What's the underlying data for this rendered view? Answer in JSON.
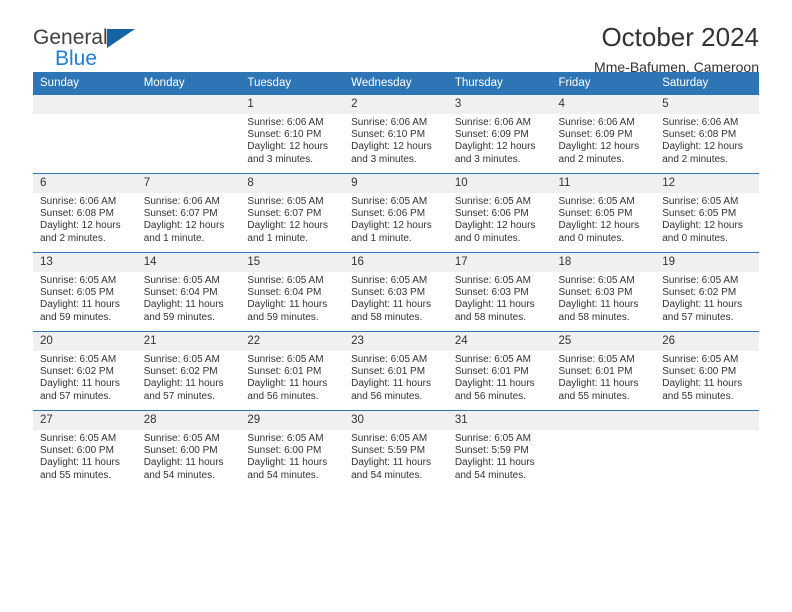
{
  "brand": {
    "name_top": "General",
    "name_bottom": "Blue",
    "triangle_color": "#1464a5",
    "blue_text_color": "#1b7fd4"
  },
  "header": {
    "title": "October 2024",
    "subtitle": "Mme-Bafumen, Cameroon",
    "accent_color": "#2e75b6",
    "daynum_band_color": "#f0f0f0"
  },
  "calendar": {
    "weekday_headers": [
      "Sunday",
      "Monday",
      "Tuesday",
      "Wednesday",
      "Thursday",
      "Friday",
      "Saturday"
    ],
    "labels": {
      "sunrise_prefix": "Sunrise:",
      "sunset_prefix": "Sunset:",
      "daylight_prefix": "Daylight:"
    },
    "weeks": [
      [
        {
          "day": "",
          "empty": true,
          "sunrise": "",
          "sunset": "",
          "daylight_line1": "",
          "daylight_line2": ""
        },
        {
          "day": "",
          "empty": true,
          "sunrise": "",
          "sunset": "",
          "daylight_line1": "",
          "daylight_line2": ""
        },
        {
          "day": "1",
          "sunrise": "Sunrise: 6:06 AM",
          "sunset": "Sunset: 6:10 PM",
          "daylight_line1": "Daylight: 12 hours",
          "daylight_line2": "and 3 minutes."
        },
        {
          "day": "2",
          "sunrise": "Sunrise: 6:06 AM",
          "sunset": "Sunset: 6:10 PM",
          "daylight_line1": "Daylight: 12 hours",
          "daylight_line2": "and 3 minutes."
        },
        {
          "day": "3",
          "sunrise": "Sunrise: 6:06 AM",
          "sunset": "Sunset: 6:09 PM",
          "daylight_line1": "Daylight: 12 hours",
          "daylight_line2": "and 3 minutes."
        },
        {
          "day": "4",
          "sunrise": "Sunrise: 6:06 AM",
          "sunset": "Sunset: 6:09 PM",
          "daylight_line1": "Daylight: 12 hours",
          "daylight_line2": "and 2 minutes."
        },
        {
          "day": "5",
          "sunrise": "Sunrise: 6:06 AM",
          "sunset": "Sunset: 6:08 PM",
          "daylight_line1": "Daylight: 12 hours",
          "daylight_line2": "and 2 minutes."
        }
      ],
      [
        {
          "day": "6",
          "sunrise": "Sunrise: 6:06 AM",
          "sunset": "Sunset: 6:08 PM",
          "daylight_line1": "Daylight: 12 hours",
          "daylight_line2": "and 2 minutes."
        },
        {
          "day": "7",
          "sunrise": "Sunrise: 6:06 AM",
          "sunset": "Sunset: 6:07 PM",
          "daylight_line1": "Daylight: 12 hours",
          "daylight_line2": "and 1 minute."
        },
        {
          "day": "8",
          "sunrise": "Sunrise: 6:05 AM",
          "sunset": "Sunset: 6:07 PM",
          "daylight_line1": "Daylight: 12 hours",
          "daylight_line2": "and 1 minute."
        },
        {
          "day": "9",
          "sunrise": "Sunrise: 6:05 AM",
          "sunset": "Sunset: 6:06 PM",
          "daylight_line1": "Daylight: 12 hours",
          "daylight_line2": "and 1 minute."
        },
        {
          "day": "10",
          "sunrise": "Sunrise: 6:05 AM",
          "sunset": "Sunset: 6:06 PM",
          "daylight_line1": "Daylight: 12 hours",
          "daylight_line2": "and 0 minutes."
        },
        {
          "day": "11",
          "sunrise": "Sunrise: 6:05 AM",
          "sunset": "Sunset: 6:05 PM",
          "daylight_line1": "Daylight: 12 hours",
          "daylight_line2": "and 0 minutes."
        },
        {
          "day": "12",
          "sunrise": "Sunrise: 6:05 AM",
          "sunset": "Sunset: 6:05 PM",
          "daylight_line1": "Daylight: 12 hours",
          "daylight_line2": "and 0 minutes."
        }
      ],
      [
        {
          "day": "13",
          "sunrise": "Sunrise: 6:05 AM",
          "sunset": "Sunset: 6:05 PM",
          "daylight_line1": "Daylight: 11 hours",
          "daylight_line2": "and 59 minutes."
        },
        {
          "day": "14",
          "sunrise": "Sunrise: 6:05 AM",
          "sunset": "Sunset: 6:04 PM",
          "daylight_line1": "Daylight: 11 hours",
          "daylight_line2": "and 59 minutes."
        },
        {
          "day": "15",
          "sunrise": "Sunrise: 6:05 AM",
          "sunset": "Sunset: 6:04 PM",
          "daylight_line1": "Daylight: 11 hours",
          "daylight_line2": "and 59 minutes."
        },
        {
          "day": "16",
          "sunrise": "Sunrise: 6:05 AM",
          "sunset": "Sunset: 6:03 PM",
          "daylight_line1": "Daylight: 11 hours",
          "daylight_line2": "and 58 minutes."
        },
        {
          "day": "17",
          "sunrise": "Sunrise: 6:05 AM",
          "sunset": "Sunset: 6:03 PM",
          "daylight_line1": "Daylight: 11 hours",
          "daylight_line2": "and 58 minutes."
        },
        {
          "day": "18",
          "sunrise": "Sunrise: 6:05 AM",
          "sunset": "Sunset: 6:03 PM",
          "daylight_line1": "Daylight: 11 hours",
          "daylight_line2": "and 58 minutes."
        },
        {
          "day": "19",
          "sunrise": "Sunrise: 6:05 AM",
          "sunset": "Sunset: 6:02 PM",
          "daylight_line1": "Daylight: 11 hours",
          "daylight_line2": "and 57 minutes."
        }
      ],
      [
        {
          "day": "20",
          "sunrise": "Sunrise: 6:05 AM",
          "sunset": "Sunset: 6:02 PM",
          "daylight_line1": "Daylight: 11 hours",
          "daylight_line2": "and 57 minutes."
        },
        {
          "day": "21",
          "sunrise": "Sunrise: 6:05 AM",
          "sunset": "Sunset: 6:02 PM",
          "daylight_line1": "Daylight: 11 hours",
          "daylight_line2": "and 57 minutes."
        },
        {
          "day": "22",
          "sunrise": "Sunrise: 6:05 AM",
          "sunset": "Sunset: 6:01 PM",
          "daylight_line1": "Daylight: 11 hours",
          "daylight_line2": "and 56 minutes."
        },
        {
          "day": "23",
          "sunrise": "Sunrise: 6:05 AM",
          "sunset": "Sunset: 6:01 PM",
          "daylight_line1": "Daylight: 11 hours",
          "daylight_line2": "and 56 minutes."
        },
        {
          "day": "24",
          "sunrise": "Sunrise: 6:05 AM",
          "sunset": "Sunset: 6:01 PM",
          "daylight_line1": "Daylight: 11 hours",
          "daylight_line2": "and 56 minutes."
        },
        {
          "day": "25",
          "sunrise": "Sunrise: 6:05 AM",
          "sunset": "Sunset: 6:01 PM",
          "daylight_line1": "Daylight: 11 hours",
          "daylight_line2": "and 55 minutes."
        },
        {
          "day": "26",
          "sunrise": "Sunrise: 6:05 AM",
          "sunset": "Sunset: 6:00 PM",
          "daylight_line1": "Daylight: 11 hours",
          "daylight_line2": "and 55 minutes."
        }
      ],
      [
        {
          "day": "27",
          "sunrise": "Sunrise: 6:05 AM",
          "sunset": "Sunset: 6:00 PM",
          "daylight_line1": "Daylight: 11 hours",
          "daylight_line2": "and 55 minutes."
        },
        {
          "day": "28",
          "sunrise": "Sunrise: 6:05 AM",
          "sunset": "Sunset: 6:00 PM",
          "daylight_line1": "Daylight: 11 hours",
          "daylight_line2": "and 54 minutes."
        },
        {
          "day": "29",
          "sunrise": "Sunrise: 6:05 AM",
          "sunset": "Sunset: 6:00 PM",
          "daylight_line1": "Daylight: 11 hours",
          "daylight_line2": "and 54 minutes."
        },
        {
          "day": "30",
          "sunrise": "Sunrise: 6:05 AM",
          "sunset": "Sunset: 5:59 PM",
          "daylight_line1": "Daylight: 11 hours",
          "daylight_line2": "and 54 minutes."
        },
        {
          "day": "31",
          "sunrise": "Sunrise: 6:05 AM",
          "sunset": "Sunset: 5:59 PM",
          "daylight_line1": "Daylight: 11 hours",
          "daylight_line2": "and 54 minutes."
        },
        {
          "day": "",
          "empty": true,
          "sunrise": "",
          "sunset": "",
          "daylight_line1": "",
          "daylight_line2": ""
        },
        {
          "day": "",
          "empty": true,
          "sunrise": "",
          "sunset": "",
          "daylight_line1": "",
          "daylight_line2": ""
        }
      ]
    ]
  }
}
